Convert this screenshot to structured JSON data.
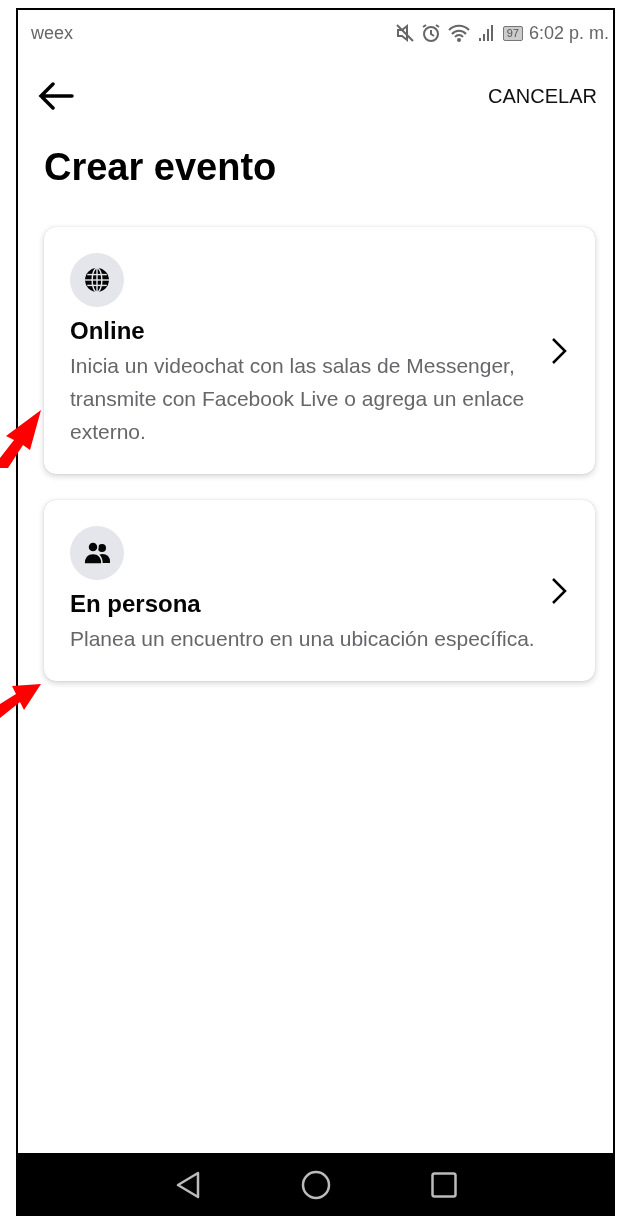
{
  "status_bar": {
    "app": "weex",
    "battery": "97",
    "time": "6:02 p. m."
  },
  "header": {
    "cancel": "CANCELAR"
  },
  "title": "Crear evento",
  "options": [
    {
      "kind": "online",
      "title": "Online",
      "description": "Inicia un videochat con las salas de Messenger, transmite con Facebook Live o agrega un enlace externo."
    },
    {
      "kind": "in_person",
      "title": "En persona",
      "description": "Planea un encuentro en una ubicación específica."
    }
  ]
}
